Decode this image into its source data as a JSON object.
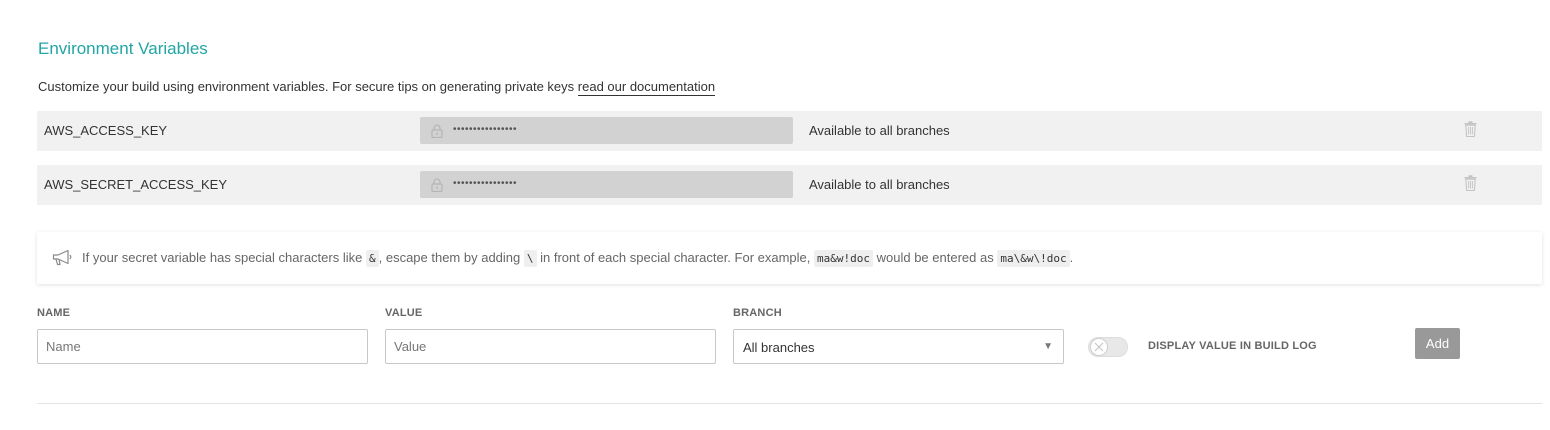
{
  "section": {
    "title": "Environment Variables",
    "description": "Customize your build using environment variables. For secure tips on generating private keys",
    "doc_link": "read our documentation"
  },
  "env_vars": [
    {
      "name": "AWS_ACCESS_KEY",
      "masked_value": "••••••••••••••••",
      "branch": "Available to all branches"
    },
    {
      "name": "AWS_SECRET_ACCESS_KEY",
      "masked_value": "••••••••••••••••",
      "branch": "Available to all branches"
    }
  ],
  "notice": {
    "part1": "If your secret variable has special characters like",
    "char_example": "&",
    "part2": ", escape them by adding",
    "escape_char": "\\",
    "part3": "in front of each special character. For example,",
    "example_raw": "ma&w!doc",
    "part4": "would be entered as",
    "example_escaped": "ma\\&w\\!doc",
    "part5": "."
  },
  "form": {
    "name_label": "NAME",
    "name_placeholder": "Name",
    "value_label": "VALUE",
    "value_placeholder": "Value",
    "branch_label": "BRANCH",
    "branch_selected": "All branches",
    "display_toggle_label": "DISPLAY VALUE IN BUILD LOG",
    "display_toggle_on": false,
    "add_button": "Add"
  },
  "colors": {
    "accent": "#22a5a5",
    "row_bg": "#f1f1f1",
    "masked_bg": "#d2d2d2",
    "button_bg": "#999999"
  }
}
